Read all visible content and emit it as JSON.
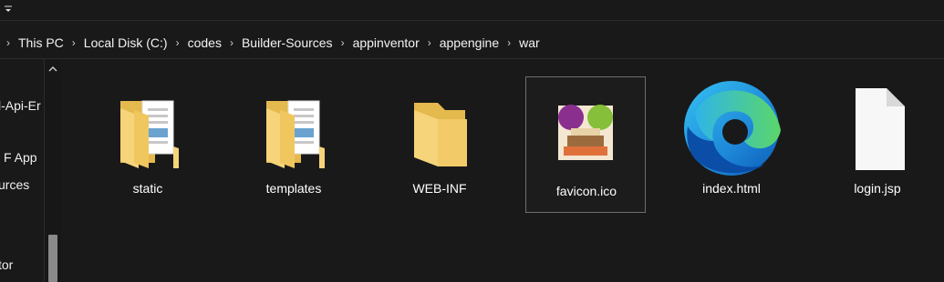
{
  "breadcrumb": {
    "items": [
      "This PC",
      "Local Disk (C:)",
      "codes",
      "Builder-Sources",
      "appinventor",
      "appengine",
      "war"
    ]
  },
  "nav_pane": {
    "items": [
      "l-Api-Er",
      "F App",
      "urces",
      "tor"
    ]
  },
  "files": [
    {
      "name": "static",
      "icon": "folder-with-documents-icon"
    },
    {
      "name": "templates",
      "icon": "folder-with-documents-icon"
    },
    {
      "name": "WEB-INF",
      "icon": "folder-icon"
    },
    {
      "name": "favicon.ico",
      "icon": "favicon-thumbnail-icon"
    },
    {
      "name": "index.html",
      "icon": "edge-browser-icon"
    },
    {
      "name": "login.jsp",
      "icon": "blank-document-icon"
    }
  ],
  "colors": {
    "background": "#191919",
    "folder": "#F6D47A",
    "folder_dark": "#E4B94D",
    "selection_border": "#6e6e6e"
  }
}
